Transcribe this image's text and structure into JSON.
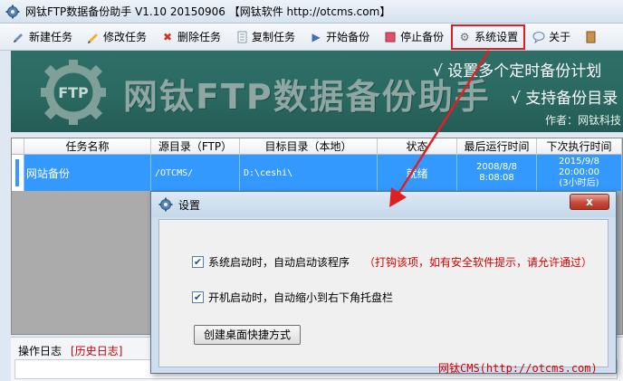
{
  "window": {
    "title": "网钛FTP数据备份助手 V1.10 20150906 【网钛软件 http://otcms.com】"
  },
  "toolbar": {
    "items": [
      {
        "label": "新建任务",
        "icon": "new-task-icon"
      },
      {
        "label": "修改任务",
        "icon": "edit-pencil-icon"
      },
      {
        "label": "删除任务",
        "icon": "delete-x-icon"
      },
      {
        "label": "复制任务",
        "icon": "copy-document-icon"
      },
      {
        "label": "开始备份",
        "icon": "play-icon"
      },
      {
        "label": "停止备份",
        "icon": "stop-square-icon"
      },
      {
        "label": "系统设置",
        "icon": "gear-icon"
      },
      {
        "label": "关于",
        "icon": "info-bubble-icon"
      }
    ]
  },
  "banner": {
    "title": "网钛FTP数据备份助手",
    "feature1": "√ 设置多个定时备份计划",
    "feature2": "√ 支持备份目录",
    "author": "作者：网钛科技"
  },
  "table": {
    "headers": [
      "任务名称",
      "源目录（FTP）",
      "目标目录（本地）",
      "状态",
      "最后运行时间",
      "下次执行时间"
    ],
    "rows": [
      {
        "name": "网站备份",
        "source": "/OTCMS/",
        "target": "D:\\ceshi\\",
        "status": "就绪",
        "last_run_date": "2008/8/8",
        "last_run_time": "8:08:08",
        "next_run_date": "2015/9/8",
        "next_run_time": "20:00:00",
        "next_run_note": "(3小时后)"
      }
    ]
  },
  "log": {
    "tab_log": "操作日志",
    "tab_history": "[历史日志]"
  },
  "dialog": {
    "title": "设置",
    "close_label": "x",
    "option1_label": "系统启动时，自动启动该程序",
    "option1_checked": true,
    "option1_note": "（打钩该项，如有安全软件提示，请允许通过）",
    "option2_label": "开机启动时，自动缩小到右下角托盘栏",
    "option2_checked": true,
    "shortcut_button": "创建桌面快捷方式"
  },
  "watermark": "网钛CMS(http://otcms.com)",
  "colors": {
    "highlight_red": "#e02020",
    "banner_green": "#2a6961",
    "selected_row_blue": "#3399ff",
    "note_red": "#d40000"
  }
}
